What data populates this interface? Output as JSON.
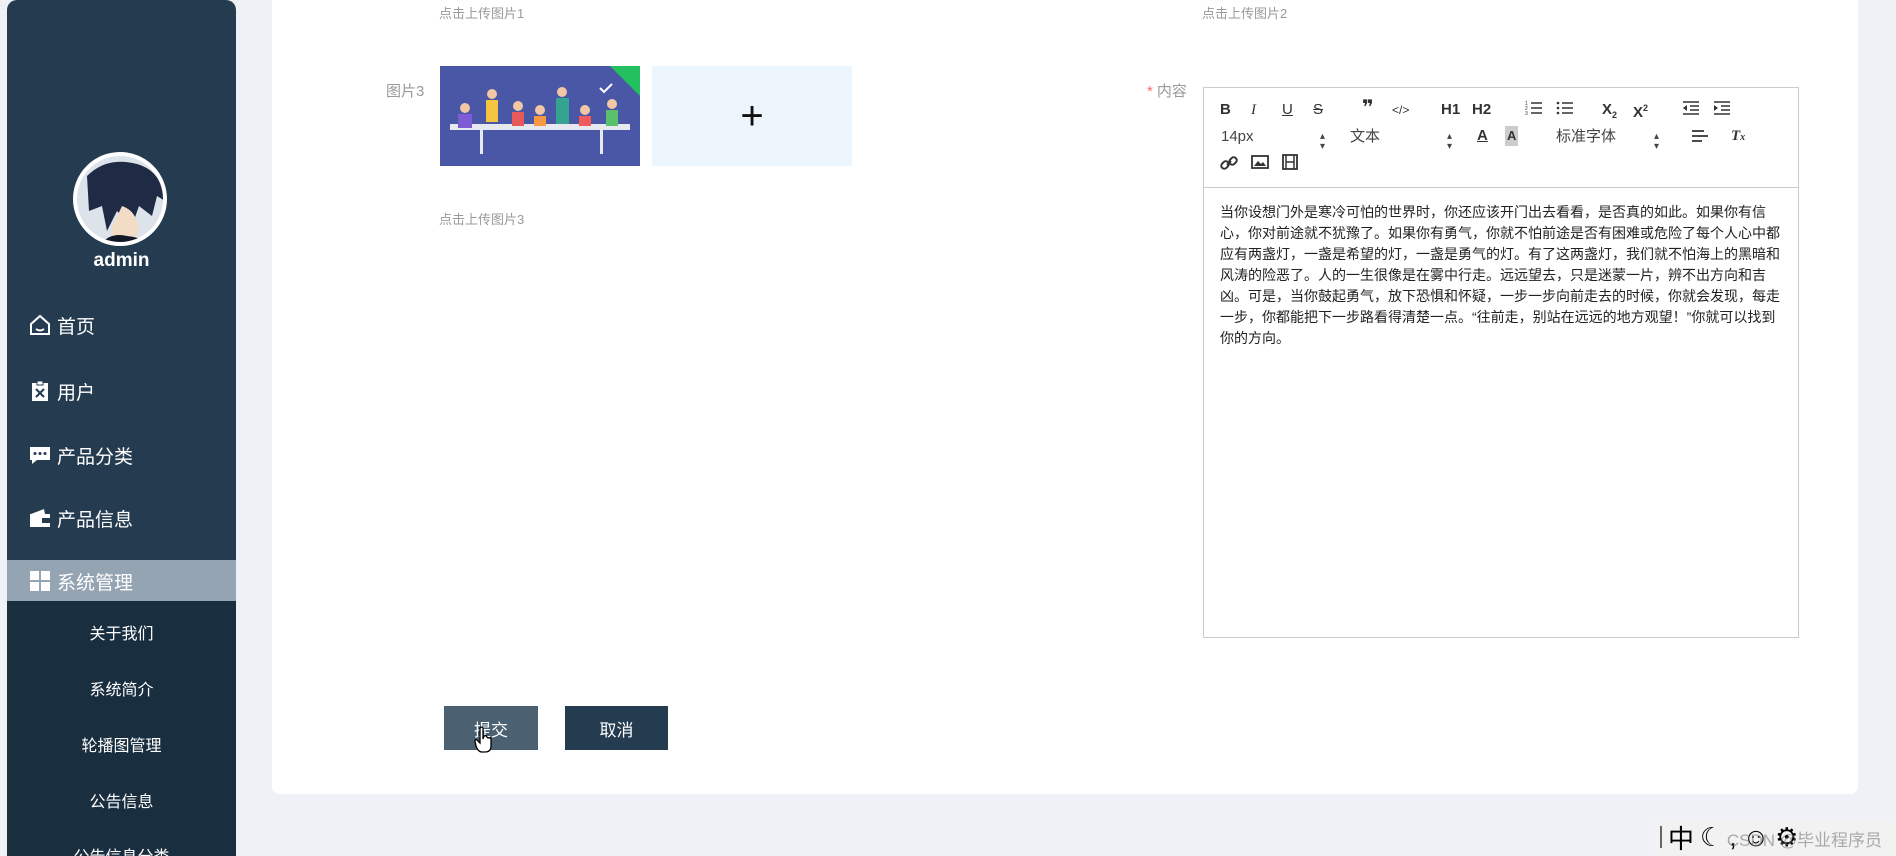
{
  "sidebar": {
    "username": "admin",
    "nav": [
      {
        "label": "首页",
        "icon": "home-icon"
      },
      {
        "label": "用户",
        "icon": "clipboard-x-icon"
      },
      {
        "label": "产品分类",
        "icon": "chat-icon"
      },
      {
        "label": "产品信息",
        "icon": "wallet-icon"
      },
      {
        "label": "系统管理",
        "icon": "grid-icon"
      }
    ],
    "submenu": [
      "关于我们",
      "系统简介",
      "轮播图管理",
      "公告信息",
      "公告信息分类"
    ]
  },
  "form": {
    "hint1": "点击上传图片1",
    "hint2": "点击上传图片2",
    "hint3": "点击上传图片3",
    "image3_label": "图片3",
    "content_required": "*",
    "content_label": "内容",
    "upload_plus": "+"
  },
  "editor": {
    "font_size": "14px",
    "text_type": "文本",
    "font_family": "标准字体",
    "h1": "H1",
    "h2": "H2",
    "content": "当你设想门外是寒冷可怕的世界时，你还应该开门出去看看，是否真的如此。如果你有信心，你对前途就不犹豫了。如果你有勇气，你就不怕前途是否有困难或危险了每个人心中都应有两盏灯，一盏是希望的灯，一盏是勇气的灯。有了这两盏灯，我们就不怕海上的黑暗和风涛的险恶了。人的一生很像是在雾中行走。远远望去，只是迷蒙一片，辨不出方向和吉凶。可是，当你鼓起勇气，放下恐惧和怀疑，一步一步向前走去的时候，你就会发现，每走一步，你都能把下一步路看得清楚一点。“往前走，别站在远远的地方观望！”你就可以找到你的方向。"
  },
  "buttons": {
    "submit": "提交",
    "cancel": "取消"
  },
  "taskbar": {
    "ime_char": "中",
    "watermark": "CSDN @毕业程序员"
  },
  "colors": {
    "sidebar_bg": "#243b50",
    "active_item": "#94a4b2",
    "submit_btn": "#4b6172",
    "cancel_btn": "#243b50",
    "required": "#f56c6c"
  }
}
